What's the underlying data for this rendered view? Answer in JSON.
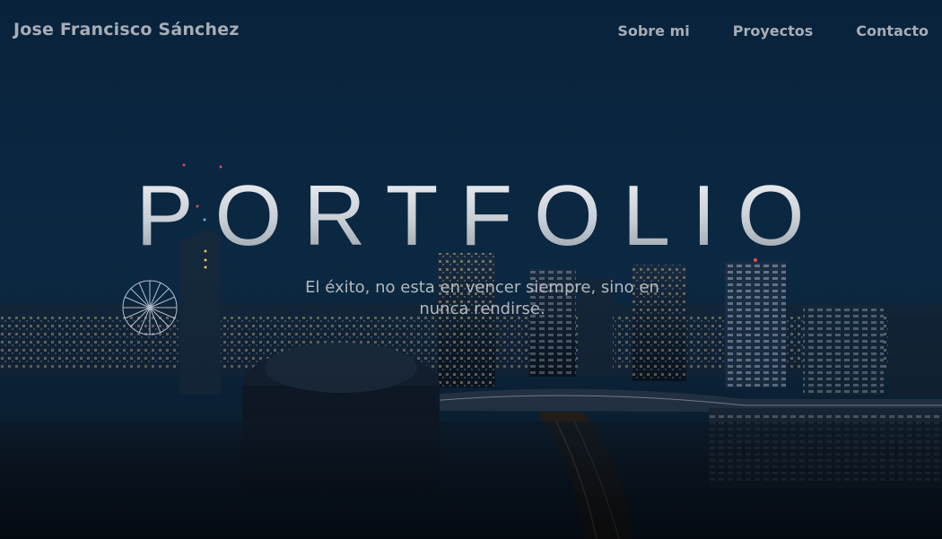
{
  "nav": {
    "brand": "Jose Francisco Sánchez",
    "links": [
      "Sobre mi",
      "Proyectos",
      "Contacto"
    ]
  },
  "hero": {
    "title": "PORTFOLIO",
    "tagline": "El éxito, no esta en vencer siempre, sino en nunca rendirse."
  },
  "colors": {
    "sky_top": "#0a2540",
    "text_muted": "#a6adb6",
    "city_lights": "#f2c14e"
  }
}
